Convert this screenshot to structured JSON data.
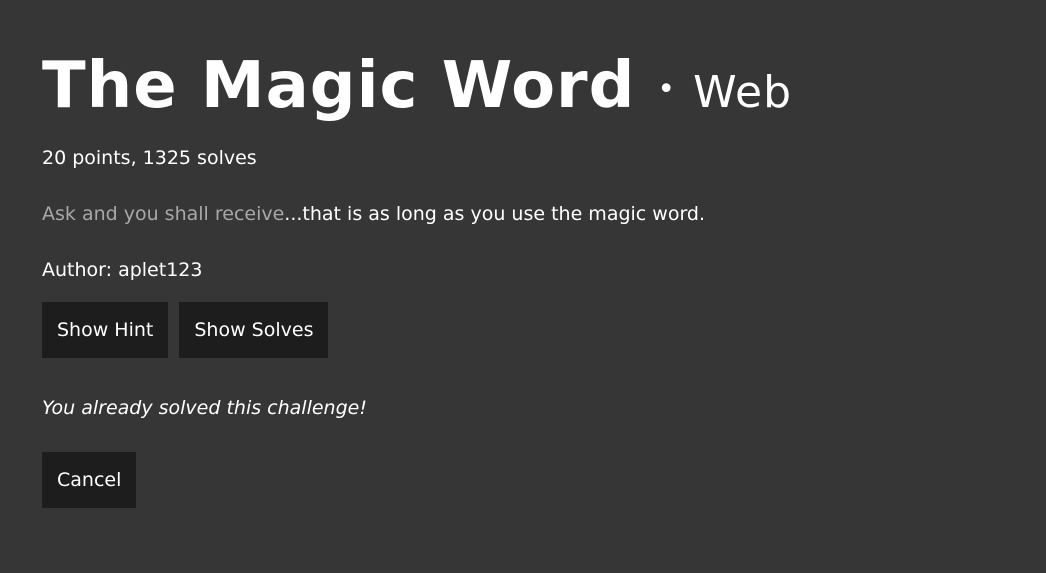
{
  "challenge": {
    "title": "The Magic Word",
    "separator": "•",
    "category": "Web",
    "meta": "20 points, 1325 solves",
    "description_dim": "Ask and you shall receive",
    "description_rest": "...that is as long as you use the magic word.",
    "author": "Author: aplet123",
    "solved_message": "You already solved this challenge!"
  },
  "buttons": {
    "show_hint": "Show Hint",
    "show_solves": "Show Solves",
    "cancel": "Cancel"
  },
  "colors": {
    "background": "#363636",
    "button_bg": "#1d1d1d",
    "text": "#ffffff",
    "dim_text": "#a8a8a8"
  }
}
